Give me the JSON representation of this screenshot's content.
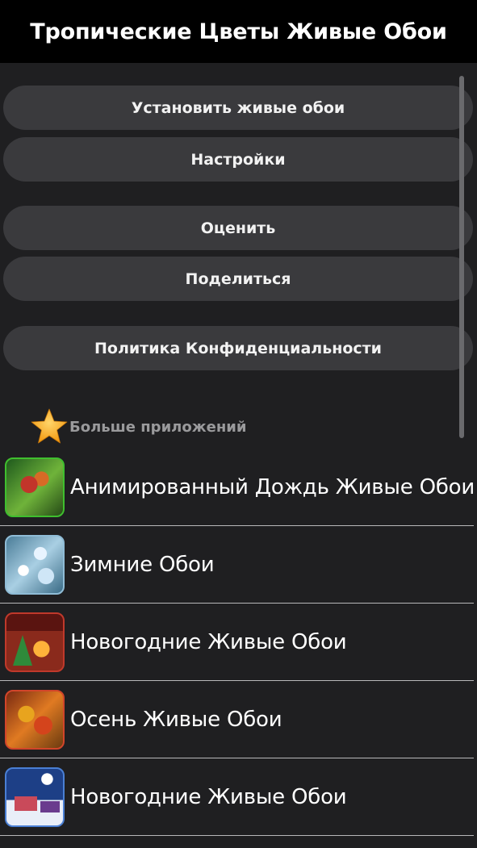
{
  "header": {
    "title": "Тропические Цветы Живые Обои"
  },
  "buttons": {
    "set_wallpaper": "Установить живые обои",
    "settings": "Настройки",
    "rate": "Оценить",
    "share": "Поделиться",
    "privacy": "Политика Конфиденциальности"
  },
  "more_apps": {
    "label": "Больше приложений",
    "icon": "star-icon",
    "items": [
      {
        "name": "Анимированный Дождь Живые Обои",
        "icon": "butterfly-rain-icon"
      },
      {
        "name": "Зимние Обои",
        "icon": "winter-snow-icon"
      },
      {
        "name": "Новогодние Живые Обои",
        "icon": "christmas-fireplace-icon"
      },
      {
        "name": "Осень Живые Обои",
        "icon": "autumn-leaves-icon"
      },
      {
        "name": "Новогодние Живые Обои",
        "icon": "christmas-village-icon"
      }
    ]
  },
  "colors": {
    "background": "#1f1f21",
    "title_bar": "#000000",
    "button": "#3a3a3d",
    "star": "#f5a623"
  }
}
